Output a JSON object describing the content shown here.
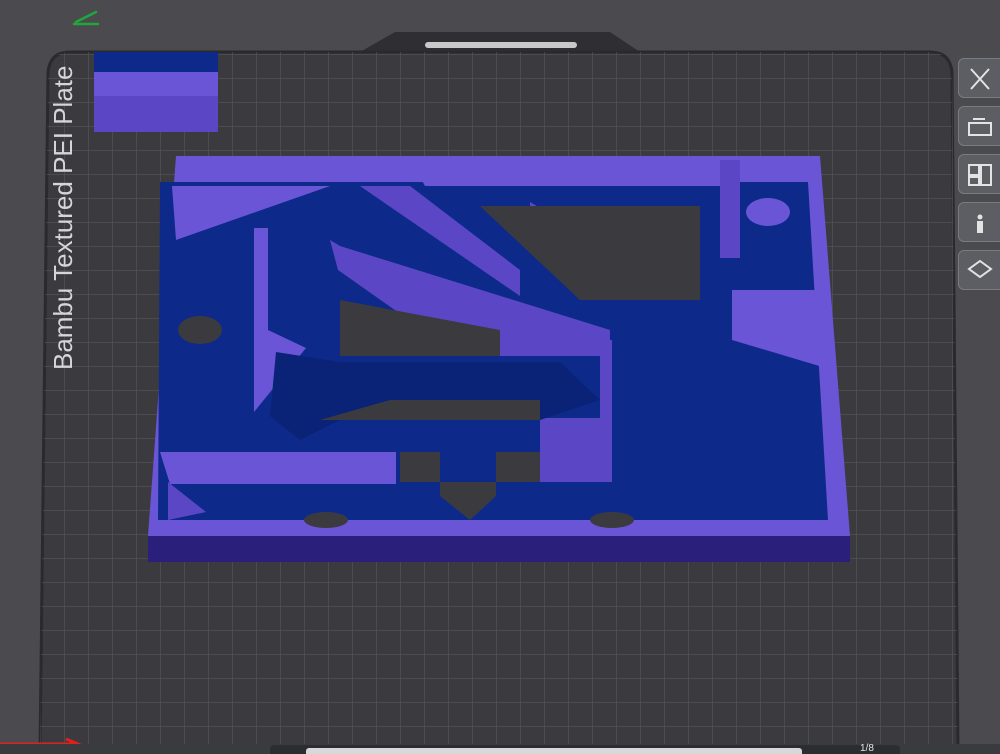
{
  "plate": {
    "label": "Bambu Textured PEI Plate"
  },
  "colors": {
    "background": "#4b4b4f",
    "plate_surface": "#3a3a3e",
    "grid_line": "#55565b",
    "model_side": "#5b47c6",
    "model_wall_top": "#6a55d6",
    "model_floor": "#0d2a8a",
    "model_edge": "#2a1f7a",
    "x_axis": "#e0201e",
    "y_axis": "#1fa83a"
  },
  "toolbar": {
    "items": [
      {
        "icon": "close-x-icon"
      },
      {
        "icon": "auto-orient-icon"
      },
      {
        "icon": "arrange-icon"
      },
      {
        "icon": "info-icon"
      },
      {
        "icon": "layers-icon"
      }
    ]
  },
  "bottom": {
    "slider_label": "1/8"
  }
}
